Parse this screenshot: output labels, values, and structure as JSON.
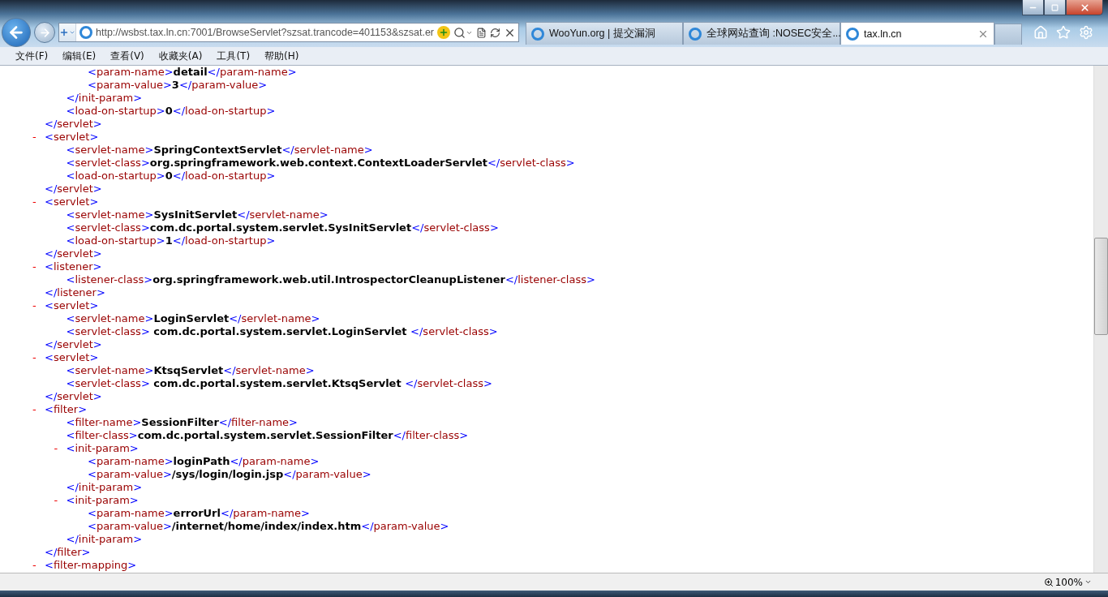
{
  "browser": {
    "url": "http://wsbst.tax.ln.cn:7001/BrowseServlet?szsat.trancode=401153&szsat.er",
    "tabs": [
      {
        "title": "WooYun.org | 提交漏洞",
        "selected": false
      },
      {
        "title": "全球网站查询 :NOSEC安全...",
        "selected": false
      },
      {
        "title": "tax.ln.cn",
        "selected": true
      }
    ],
    "menu": [
      "文件(F)",
      "编辑(E)",
      "查看(V)",
      "收藏夹(A)",
      "工具(T)",
      "帮助(H)"
    ]
  },
  "document": [
    {
      "kind": "tail",
      "close": "</servlet>",
      "children": [
        {
          "kind": "tail",
          "close": "</init-param>",
          "children": [
            {
              "kind": "leaf",
              "open": "<param-name>",
              "value": "detail",
              "close": "</param-name>"
            },
            {
              "kind": "leaf",
              "open": "<param-value>",
              "value": "3",
              "close": "</param-value>"
            }
          ]
        },
        {
          "kind": "leaf",
          "open": "<load-on-startup>",
          "value": "0",
          "close": "</load-on-startup>"
        }
      ]
    },
    {
      "kind": "element",
      "toggle": "-",
      "open": "<servlet>",
      "close": "</servlet>",
      "children": [
        {
          "kind": "leaf",
          "open": "<servlet-name>",
          "value": "SpringContextServlet",
          "close": "</servlet-name>"
        },
        {
          "kind": "leaf",
          "open": "<servlet-class>",
          "value": "org.springframework.web.context.ContextLoaderServlet",
          "close": "</servlet-class>"
        },
        {
          "kind": "leaf",
          "open": "<load-on-startup>",
          "value": "0",
          "close": "</load-on-startup>"
        }
      ]
    },
    {
      "kind": "element",
      "toggle": "-",
      "open": "<servlet>",
      "close": "</servlet>",
      "children": [
        {
          "kind": "leaf",
          "open": "<servlet-name>",
          "value": "SysInitServlet",
          "close": "</servlet-name>"
        },
        {
          "kind": "leaf",
          "open": "<servlet-class>",
          "value": "com.dc.portal.system.servlet.SysInitServlet",
          "close": "</servlet-class>"
        },
        {
          "kind": "leaf",
          "open": "<load-on-startup>",
          "value": "1",
          "close": "</load-on-startup>"
        }
      ]
    },
    {
      "kind": "element",
      "toggle": "-",
      "open": "<listener>",
      "close": "</listener>",
      "children": [
        {
          "kind": "leaf",
          "open": "<listener-class>",
          "value": "org.springframework.web.util.IntrospectorCleanupListener",
          "close": "</listener-class>"
        }
      ]
    },
    {
      "kind": "element",
      "toggle": "-",
      "open": "<servlet>",
      "close": "</servlet>",
      "children": [
        {
          "kind": "leaf",
          "open": "<servlet-name>",
          "value": "LoginServlet",
          "close": "</servlet-name>"
        },
        {
          "kind": "leaf",
          "open": "<servlet-class>",
          "value": " com.dc.portal.system.servlet.LoginServlet ",
          "close": "</servlet-class>"
        }
      ]
    },
    {
      "kind": "element",
      "toggle": "-",
      "open": "<servlet>",
      "close": "</servlet>",
      "children": [
        {
          "kind": "leaf",
          "open": "<servlet-name>",
          "value": "KtsqServlet",
          "close": "</servlet-name>"
        },
        {
          "kind": "leaf",
          "open": "<servlet-class>",
          "value": " com.dc.portal.system.servlet.KtsqServlet ",
          "close": "</servlet-class>"
        }
      ]
    },
    {
      "kind": "element",
      "toggle": "-",
      "open": "<filter>",
      "close": "</filter>",
      "children": [
        {
          "kind": "leaf",
          "open": "<filter-name>",
          "value": "SessionFilter",
          "close": "</filter-name>"
        },
        {
          "kind": "leaf",
          "open": "<filter-class>",
          "value": "com.dc.portal.system.servlet.SessionFilter",
          "close": "</filter-class>"
        },
        {
          "kind": "element",
          "toggle": "-",
          "open": "<init-param>",
          "close": "</init-param>",
          "children": [
            {
              "kind": "leaf",
              "open": "<param-name>",
              "value": "loginPath",
              "close": "</param-name>"
            },
            {
              "kind": "leaf",
              "open": "<param-value>",
              "value": "/sys/login/login.jsp",
              "close": "</param-value>"
            }
          ]
        },
        {
          "kind": "element",
          "toggle": "-",
          "open": "<init-param>",
          "close": "</init-param>",
          "children": [
            {
              "kind": "leaf",
              "open": "<param-name>",
              "value": "errorUrl",
              "close": "</param-name>"
            },
            {
              "kind": "leaf",
              "open": "<param-value>",
              "value": "/internet/home/index/index.htm",
              "close": "</param-value>"
            }
          ]
        }
      ]
    },
    {
      "kind": "open",
      "toggle": "-",
      "open": "<filter-mapping>"
    }
  ],
  "status_bar": {
    "zoom": "100%"
  }
}
